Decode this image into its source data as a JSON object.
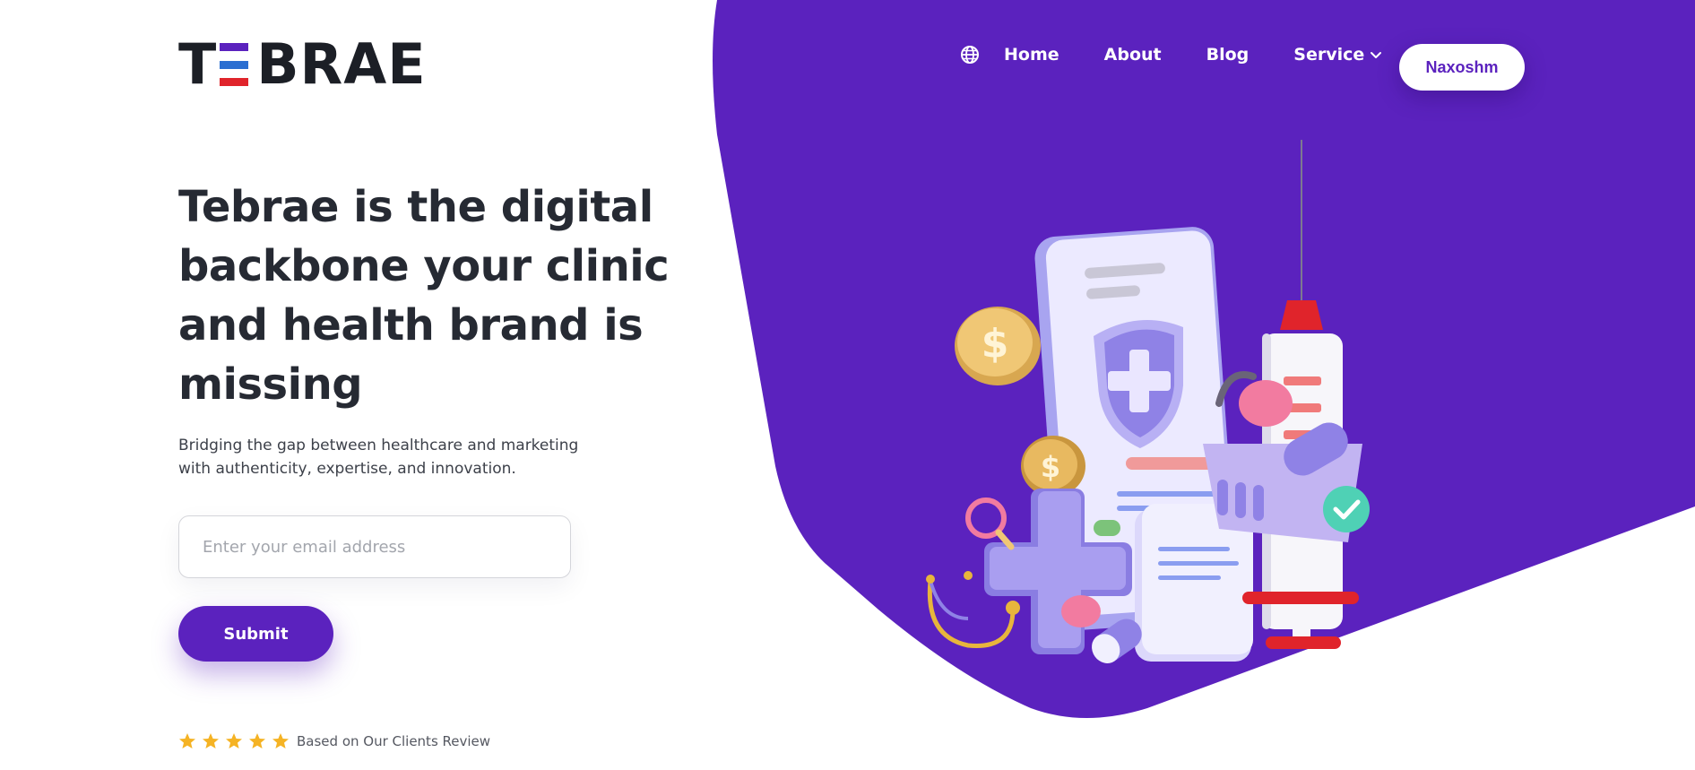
{
  "brand": {
    "logo_text_left": "T",
    "logo_text_right": "BRAE",
    "logo_bar_colors": [
      "#5b22be",
      "#2b6fd1",
      "#e0242b"
    ]
  },
  "nav": {
    "language_icon": "globe-icon",
    "links": [
      "Home",
      "About",
      "Blog",
      "Service"
    ],
    "service_icon": "chevron-down-icon",
    "cta_label": "Naxoshm"
  },
  "hero": {
    "title": "Tebrae is the digital backbone your clinic and health brand is missing",
    "subtitle_line1": "Bridging the gap between healthcare and marketing",
    "subtitle_line2": "with authenticity, expertise, and innovation.",
    "email_placeholder": "Enter your email address",
    "submit_label": "Submit"
  },
  "rating": {
    "stars": 5,
    "star_icon": "star-icon",
    "text": "Based on Our Clients Review"
  },
  "colors": {
    "accent": "#5b22be",
    "heading": "#262a33",
    "star": "#f5b324"
  }
}
